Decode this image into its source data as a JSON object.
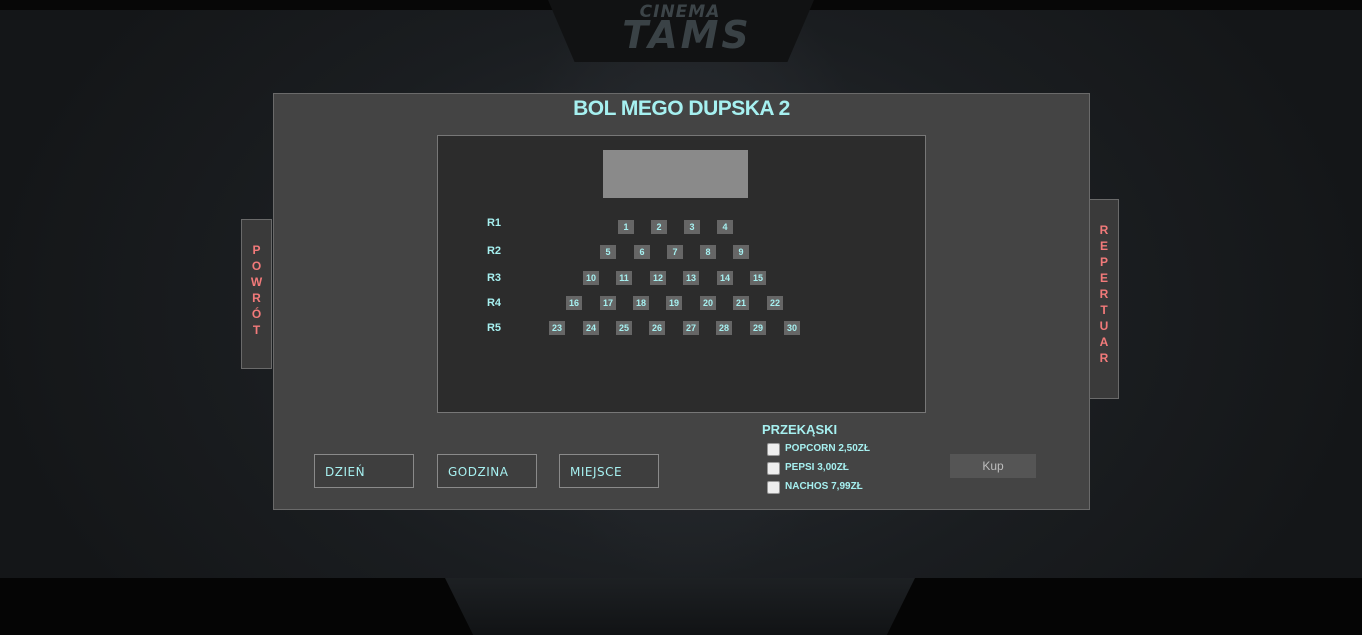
{
  "logo": {
    "top": "CINEMA",
    "main": "TAMS"
  },
  "movie": {
    "title": "BOL MEGO DUPSKA 2"
  },
  "nav": {
    "back_letters": [
      "P",
      "O",
      "W",
      "R",
      "Ó",
      "T"
    ],
    "repertoire_letters": [
      "R",
      "E",
      "P",
      "E",
      "R",
      "T",
      "U",
      "A",
      "R"
    ]
  },
  "rows": [
    {
      "label": "R1",
      "seats": [
        "1",
        "2",
        "3",
        "4"
      ]
    },
    {
      "label": "R2",
      "seats": [
        "5",
        "6",
        "7",
        "8",
        "9"
      ]
    },
    {
      "label": "R3",
      "seats": [
        "10",
        "11",
        "12",
        "13",
        "14",
        "15"
      ]
    },
    {
      "label": "R4",
      "seats": [
        "16",
        "17",
        "18",
        "19",
        "20",
        "21",
        "22"
      ]
    },
    {
      "label": "R5",
      "seats": [
        "23",
        "24",
        "25",
        "26",
        "27",
        "28",
        "29",
        "30"
      ]
    }
  ],
  "selectors": {
    "day": "DZIEŃ",
    "hour": "GODZINA",
    "seat": "MIEJSCE"
  },
  "snacks": {
    "title": "PRZEKĄSKI",
    "items": [
      "POPCORN 2,50ZŁ",
      "PEPSI 3,00ZŁ",
      "NACHOS 7,99ZŁ"
    ]
  },
  "buy_label": "Kup",
  "colors": {
    "accent_text": "#a6f0f0",
    "nav_text": "#f27a7a",
    "panel": "#444444"
  }
}
